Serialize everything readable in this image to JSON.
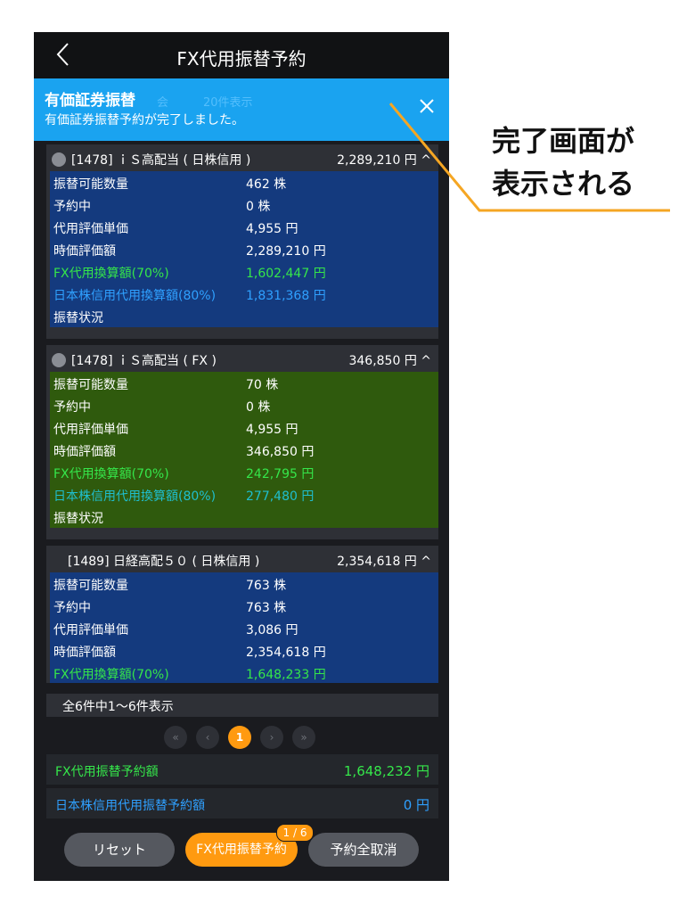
{
  "header": {
    "title": "FX代用振替予約"
  },
  "toast": {
    "title": "有価証券振替",
    "message": "有価証券振替予約が完了しました。",
    "ghost_left": "会",
    "ghost_count": "20件表示"
  },
  "cards": [
    {
      "name": "[1478] ｉＳ高配当 ( 日株信用 )",
      "amount": "2,289,210 円 ^",
      "rows": [
        {
          "label": "振替可能数量",
          "value": "462 株"
        },
        {
          "label": "予約中",
          "value": "0 株"
        },
        {
          "label": "代用評価単価",
          "value": "4,955 円"
        },
        {
          "label": "時価評価額",
          "value": "2,289,210 円"
        },
        {
          "label": "FX代用換算額(70%)",
          "value": "1,602,447 円"
        },
        {
          "label": "日本株信用代用換算額(80%)",
          "value": "1,831,368 円"
        },
        {
          "label": "振替状況",
          "value": ""
        }
      ]
    },
    {
      "name": "[1478] ｉＳ高配当 ( FX )",
      "amount": "346,850 円 ^",
      "rows": [
        {
          "label": "振替可能数量",
          "value": "70 株"
        },
        {
          "label": "予約中",
          "value": "0 株"
        },
        {
          "label": "代用評価単価",
          "value": "4,955 円"
        },
        {
          "label": "時価評価額",
          "value": "346,850 円"
        },
        {
          "label": "FX代用換算額(70%)",
          "value": "242,795 円"
        },
        {
          "label": "日本株信用代用換算額(80%)",
          "value": "277,480 円"
        },
        {
          "label": "振替状況",
          "value": ""
        }
      ]
    },
    {
      "name": "[1489] 日経高配５０ ( 日株信用 )",
      "amount": "2,354,618 円 ^",
      "rows": [
        {
          "label": "振替可能数量",
          "value": "763 株"
        },
        {
          "label": "予約中",
          "value": "763 株"
        },
        {
          "label": "代用評価単価",
          "value": "3,086 円"
        },
        {
          "label": "時価評価額",
          "value": "2,354,618 円"
        },
        {
          "label": "FX代用換算額(70%)",
          "value": "1,648,233 円"
        }
      ]
    }
  ],
  "summary": "全6件中1～6件表示",
  "pager": {
    "current": "1"
  },
  "totals": [
    {
      "label": "FX代用振替予約額",
      "value": "1,648,232 円"
    },
    {
      "label": "日本株信用代用振替予約額",
      "value": "0 円"
    }
  ],
  "buttons": {
    "reset": "リセット",
    "reserve": "FX代用振替予約",
    "reserve_badge": "1 / 6",
    "cancel_all": "予約全取消"
  },
  "annotation": {
    "line1": "完了画面が",
    "line2": "表示される"
  },
  "colors": {
    "accent": "#ff9a10",
    "toast": "#1aa3f0",
    "fx_green": "#35e64a",
    "jp_cyan": "#2fa0ff"
  }
}
